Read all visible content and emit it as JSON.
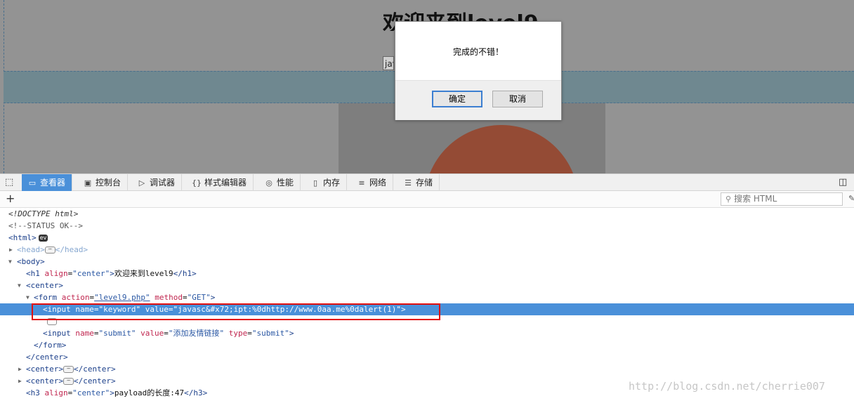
{
  "page": {
    "heading": "欢迎来到level9",
    "input_value": "javascr"
  },
  "dialog": {
    "message": "完成的不错！",
    "ok_label": "确定",
    "cancel_label": "取消"
  },
  "toolbar": {
    "tabs": [
      {
        "label": "查看器",
        "icon": "inspector-icon",
        "active": true
      },
      {
        "label": "控制台",
        "icon": "console-icon"
      },
      {
        "label": "调试器",
        "icon": "debugger-icon"
      },
      {
        "label": "样式编辑器",
        "icon": "style-editor-icon"
      },
      {
        "label": "性能",
        "icon": "performance-icon"
      },
      {
        "label": "内存",
        "icon": "memory-icon"
      },
      {
        "label": "网络",
        "icon": "network-icon"
      },
      {
        "label": "存储",
        "icon": "storage-icon"
      }
    ]
  },
  "search": {
    "placeholder": "搜索 HTML"
  },
  "tree": {
    "doctype": "<!DOCTYPE html>",
    "comment": "<!--STATUS OK-->",
    "html_open": "<html>",
    "ev_badge": "ev",
    "head_open": "<head>",
    "head_close": "</head>",
    "body_open": "<body>",
    "h1": {
      "open": "<h1",
      "attr": "align",
      "val": "\"center\"",
      "text": "欢迎来到level9",
      "close": "</h1>"
    },
    "center_open": "<center>",
    "form": {
      "open": "<form",
      "attr1": "action",
      "val1": "\"level9.php\"",
      "attr2": "method",
      "val2": "\"GET\"",
      "close": "</form>"
    },
    "input1": {
      "open": "<input",
      "attr1": "name",
      "val1": "\"keyword\"",
      "attr2": "value",
      "val2": "\"javasc&#x72;ipt:%0dhttp://www.0aa.me%0dalert(1)\"",
      "end": ">"
    },
    "input2": {
      "open": "<input",
      "attr1": "name",
      "val1": "\"submit\"",
      "attr2": "value",
      "val2": "\"添加友情链接\"",
      "attr3": "type",
      "val3": "\"submit\"",
      "end": ">"
    },
    "center_close": "</center>",
    "center_collapsed_open": "<center>",
    "center_collapsed_close": "</center>",
    "h3": {
      "open": "<h3",
      "attr": "align",
      "val": "\"center\"",
      "text": "payload的长度:47",
      "close": "</h3>"
    }
  },
  "watermark": "http://blog.csdn.net/cherrie007"
}
